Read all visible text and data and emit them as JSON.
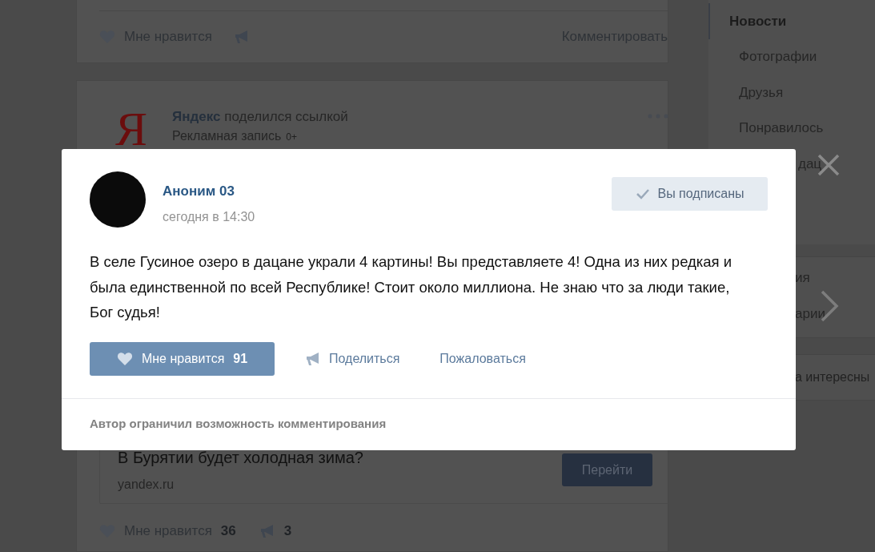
{
  "feed": {
    "posts": [
      {
        "like_label": "Мне нравится",
        "comment_label": "Комментировать"
      },
      {
        "logo": "Я",
        "author": "Яндекс",
        "action": "поделился ссылкой",
        "subtitle": "Рекламная запись",
        "age_rating": "0+",
        "link": {
          "title": "В Бурятии будет холодная зима?",
          "domain": "yandex.ru",
          "button": "Перейти"
        },
        "like_label": "Мне нравится",
        "likes": "36",
        "shares": "3"
      }
    ]
  },
  "sidebar": {
    "menu": [
      {
        "label": "Новости",
        "selected": true
      },
      {
        "label": "Фотографии",
        "selected": false
      },
      {
        "label": "Друзья",
        "selected": false
      },
      {
        "label": "Понравилось",
        "selected": false
      },
      {
        "label": "дац",
        "selected": false
      }
    ],
    "second_block": [
      "ия",
      "арии"
    ],
    "promo": "а интересны"
  },
  "modal": {
    "author": "Аноним 03",
    "time": "сегодня в 14:30",
    "subscribe_button": "Вы подписаны",
    "text": "В селе Гусиное озеро в дацане украли 4 картины! Вы представляете 4! Одна из них редкая и была единственной по всей Республике! Стоит около миллиона. Не знаю что за люди такие, Бог судья!",
    "like_button": {
      "label": "Мне нравится",
      "count": "91",
      "liked": true
    },
    "share_label": "Поделиться",
    "report_label": "Пожаловаться",
    "footer": "Автор ограничил возможность комментирования"
  }
}
